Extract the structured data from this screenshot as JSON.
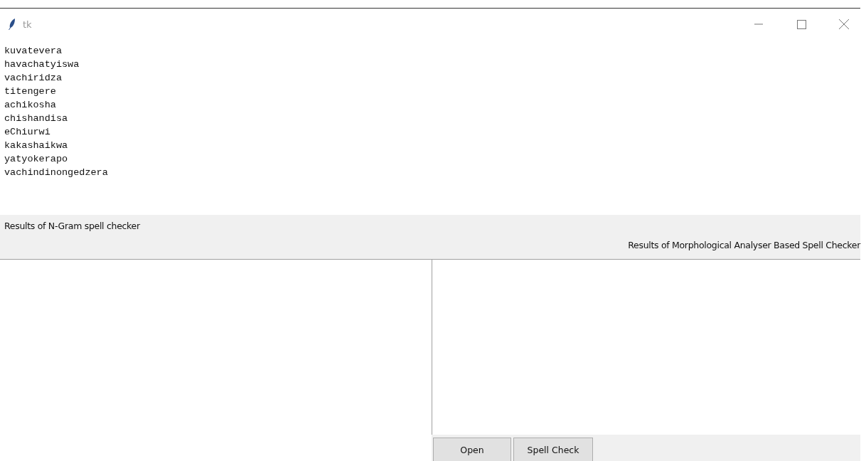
{
  "window": {
    "title": "tk"
  },
  "text_area": {
    "lines": [
      "kuvatevera",
      "havachatyiswa",
      "vachiridza",
      "titengere",
      "achikosha",
      "chishandisa",
      "eChiurwi",
      "kakashaikwa",
      "yatyokerapo",
      "vachindinongedzera"
    ]
  },
  "labels": [
    "Results of N-Gram spell checker",
    "Results of Morphological Analyser Based Spell Checker"
  ],
  "buttons": [
    "Open",
    "Spell Check"
  ]
}
